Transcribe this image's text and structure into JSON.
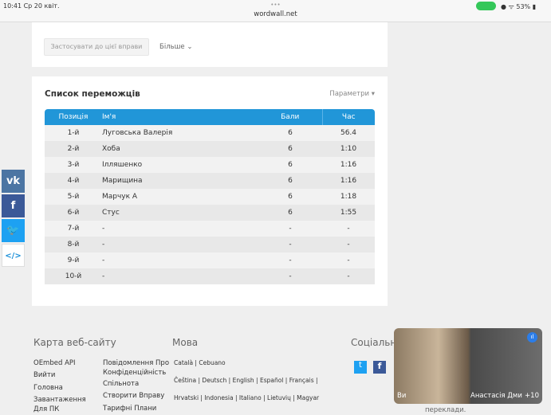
{
  "status": {
    "time": "10:41 Ср 20 квіт.",
    "url": "wordwall.net",
    "battery": "53%"
  },
  "top_card": {
    "apply_button": "Застосувати до цієї вправи",
    "more": "Більше ⌄"
  },
  "leaderboard": {
    "title": "Список переможців",
    "params": "Параметри ▾",
    "headers": [
      "Позиція",
      "Ім'я",
      "Бали",
      "Час"
    ],
    "rows": [
      [
        "1-й",
        "Луговська Валерія",
        "6",
        "56.4"
      ],
      [
        "2-й",
        "Хоба",
        "6",
        "1:10"
      ],
      [
        "3-й",
        "Ілляшенко",
        "6",
        "1:16"
      ],
      [
        "4-й",
        "Марищина",
        "6",
        "1:16"
      ],
      [
        "5-й",
        "Марчук А",
        "6",
        "1:18"
      ],
      [
        "6-й",
        "Стус",
        "6",
        "1:55"
      ],
      [
        "7-й",
        "-",
        "-",
        "-"
      ],
      [
        "8-й",
        "-",
        "-",
        "-"
      ],
      [
        "9-й",
        "-",
        "-",
        "-"
      ],
      [
        "10-й",
        "-",
        "-",
        "-"
      ]
    ]
  },
  "social_share": [
    "vk",
    "f",
    "twitter",
    "</>"
  ],
  "footer": {
    "sitemap_title": "Карта веб-сайту",
    "col1": [
      "OEmbed API",
      "Вийти",
      "Головна",
      "Завантаження Для ПК"
    ],
    "col2": [
      "Повідомлення Про Конфіденційність",
      "Спільнота",
      "Створити Вправу",
      "Тарифні Плани"
    ],
    "lang_title": "Мова",
    "langs": [
      "Català | Cebuano",
      "Čeština | Deutsch | English | Español | Français |",
      "Hrvatski | Indonesia | Italiano | Lietuvių | Magyar"
    ],
    "social_title": "Соціальні",
    "bottom_text": "переклади."
  },
  "video": {
    "self": "Ви",
    "other": "Анастасія Дми",
    "extra": "+10"
  }
}
